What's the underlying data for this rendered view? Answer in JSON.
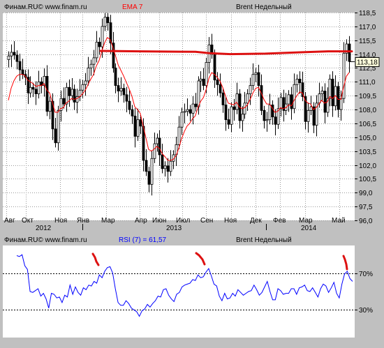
{
  "main": {
    "source": "Финам.RU© www.finam.ru",
    "indicator": "EMA 7",
    "title": "Brent Недельный",
    "last_price": "113,18",
    "y_ticks": [
      "118,5",
      "117,0",
      "115,5",
      "114,0",
      "112,5",
      "111,0",
      "109,5",
      "108,0",
      "106,5",
      "105,0",
      "103,5",
      "102,0",
      "100,5",
      "99,0",
      "97,5",
      "96,0"
    ],
    "ylim": [
      96.0,
      118.5
    ],
    "x_months": [
      "Авг",
      "Окт",
      "Ноя",
      "Янв",
      "Мар",
      "Апр",
      "Июн",
      "Июл",
      "Сен",
      "Ноя",
      "Дек",
      "Фев",
      "Мар",
      "Май"
    ],
    "x_years": [
      "2012",
      "2013",
      "2014"
    ],
    "resistance_level": 114.3,
    "colors": {
      "ema": "#ff0000",
      "resistance": "#dd1111",
      "candle": "#000000",
      "grid": "#999999"
    }
  },
  "rsi": {
    "source": "Финам.RU© www.finam.ru",
    "indicator": "RSI (7) = 61,57",
    "title": "Brent Недельный",
    "y_ticks": [
      "70%",
      "30%"
    ],
    "levels": [
      70,
      30
    ],
    "colors": {
      "line": "#0000ff",
      "marker": "#dd1111"
    }
  },
  "chart_data": [
    {
      "type": "candlestick",
      "title": "Brent Недельный",
      "ylim": [
        96.0,
        118.5
      ],
      "x": [
        "Авг",
        "Окт",
        "Ноя",
        "Янв",
        "Мар",
        "Апр",
        "Июн",
        "Июл",
        "Сен",
        "Ноя",
        "Дек",
        "Фев",
        "Мар",
        "Май"
      ],
      "close": [
        113.8,
        114.2,
        113.9,
        113.2,
        112.3,
        111.8,
        111.5,
        109.8,
        110.4,
        110.2,
        109.7,
        111.0,
        110.6,
        111.6,
        107.8,
        108.9,
        105.9,
        104.4,
        107.9,
        109.2,
        108.6,
        110.4,
        109.5,
        110.2,
        108.8,
        109.4,
        110.1,
        110.7,
        111.1,
        112.5,
        112.9,
        113.6,
        115.3,
        114.8,
        117.0,
        118.0,
        117.4,
        115.2,
        112.5,
        110.6,
        110.0,
        110.3,
        109.6,
        108.9,
        108.0,
        107.3,
        105.1,
        106.9,
        106.2,
        102.5,
        101.3,
        99.9,
        102.7,
        104.3,
        104.9,
        103.1,
        101.6,
        101.9,
        101.3,
        102.4,
        103.1,
        104.2,
        106.1,
        107.7,
        107.8,
        108.0,
        107.6,
        108.6,
        108.3,
        111.1,
        111.3,
        110.6,
        113.1,
        115.0,
        114.0,
        111.2,
        110.7,
        109.8,
        108.5,
        106.9,
        106.4,
        108.3,
        108.0,
        109.7,
        106.8,
        107.5,
        108.7,
        109.7,
        110.6,
        111.8,
        112.0,
        110.6,
        107.9,
        106.8,
        106.9,
        108.5,
        107.2,
        106.4,
        108.1,
        109.3,
        107.9,
        108.6,
        109.6,
        108.1,
        110.7,
        111.3,
        110.9,
        109.4,
        106.7,
        107.9,
        108.3,
        106.3,
        108.7,
        109.7,
        110.0,
        107.7,
        109.2,
        111.3,
        108.4,
        110.5,
        108.0,
        109.2,
        114.1,
        115.1,
        113.2
      ],
      "ema": [
        109.0,
        110.3,
        111.1,
        111.6,
        111.8,
        111.8,
        111.7,
        111.2,
        111.0,
        110.8,
        110.5,
        110.6,
        110.6,
        110.8,
        110.1,
        109.8,
        108.8,
        107.7,
        107.7,
        108.1,
        108.2,
        108.7,
        108.9,
        109.2,
        109.1,
        109.2,
        109.4,
        109.7,
        110.1,
        110.7,
        111.3,
        111.8,
        112.7,
        113.3,
        114.3,
        115.2,
        115.8,
        115.6,
        114.8,
        113.8,
        112.8,
        112.2,
        111.6,
        110.9,
        110.2,
        109.4,
        108.3,
        108.0,
        107.6,
        106.3,
        105.0,
        103.7,
        103.5,
        103.7,
        104.0,
        103.8,
        103.2,
        102.9,
        102.5,
        102.5,
        102.6,
        103.0,
        103.8,
        104.8,
        105.6,
        106.2,
        106.5,
        107.0,
        107.3,
        108.2,
        108.9,
        109.3,
        110.2,
        111.4,
        112.0,
        111.8,
        111.5,
        111.1,
        110.4,
        109.5,
        108.7,
        108.6,
        108.5,
        108.8,
        108.3,
        108.1,
        108.2,
        108.5,
        109.1,
        109.8,
        110.3,
        110.4,
        109.8,
        109.1,
        108.6,
        108.6,
        108.2,
        107.7,
        107.8,
        108.2,
        108.1,
        108.2,
        108.5,
        108.4,
        109.0,
        109.5,
        109.9,
        109.8,
        109.0,
        108.7,
        108.6,
        108.0,
        108.2,
        108.6,
        109.0,
        108.7,
        108.8,
        109.4,
        109.2,
        109.5,
        109.1,
        109.1,
        110.4,
        111.6,
        112.0
      ]
    },
    {
      "type": "line",
      "title": "Brent Недельный",
      "ylabel": "RSI (7) = 61,57",
      "ylim": [
        0,
        100
      ],
      "values": [
        89,
        88,
        90,
        78,
        74,
        50,
        49,
        51,
        53,
        45,
        48,
        42,
        32,
        48,
        47,
        43,
        44,
        38,
        46,
        44,
        57,
        47,
        55,
        49,
        46,
        54,
        52,
        57,
        56,
        61,
        59,
        68,
        65,
        72,
        76,
        77,
        70,
        53,
        38,
        35,
        35,
        40,
        37,
        32,
        30,
        28,
        23,
        29,
        31,
        36,
        33,
        37,
        40,
        45,
        44,
        52,
        53,
        46,
        42,
        39,
        47,
        49,
        55,
        57,
        58,
        59,
        63,
        62,
        68,
        65,
        66,
        71,
        75,
        67,
        58,
        56,
        45,
        40,
        48,
        42,
        43,
        48,
        45,
        52,
        49,
        46,
        48,
        50,
        51,
        57,
        52,
        46,
        49,
        55,
        61,
        50,
        41,
        41,
        53,
        51,
        47,
        48,
        48,
        53,
        53,
        47,
        54,
        55,
        57,
        51,
        50,
        54,
        49,
        44,
        53,
        58,
        56,
        49,
        54,
        60,
        48,
        43,
        58,
        69,
        72,
        64,
        61
      ]
    }
  ]
}
